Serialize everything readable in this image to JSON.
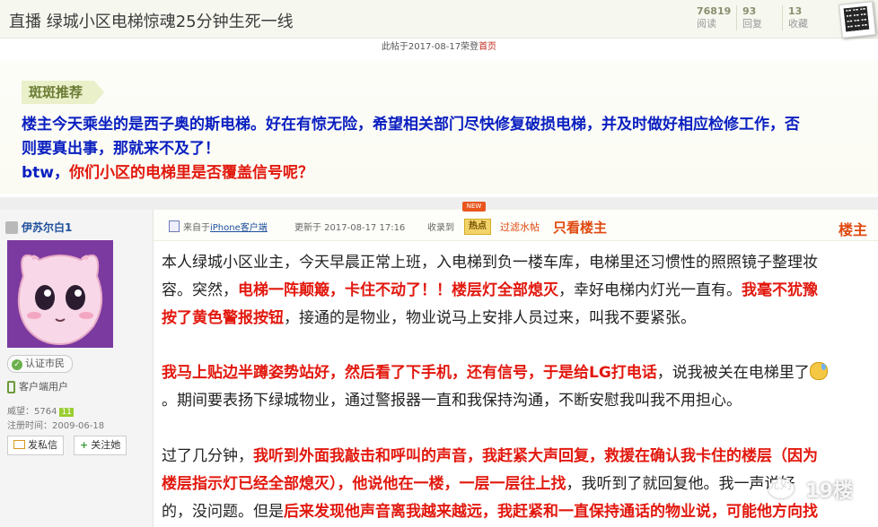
{
  "header": {
    "title": "直播 绿城小区电梯惊魂25分钟生死一线",
    "stats": [
      {
        "value": "76819",
        "label": "阅读"
      },
      {
        "value": "93",
        "label": "回复"
      },
      {
        "value": "13",
        "label": "收藏"
      }
    ],
    "pinned_text": "此帖于2017-08-17荣登",
    "pinned_link": "首页"
  },
  "recommendation": {
    "tag": "斑斑推荐",
    "line1": "楼主今天乘坐的是西子奥的斯电梯。好在有惊无险，希望相关部门尽快修复破损电梯，并及时做好相应检修工作，否",
    "line2": "则要真出事，那就来不及了！",
    "line3_blue": "btw，",
    "line3_red": "你们小区的电梯里是否覆盖信号呢？"
  },
  "user": {
    "name": "伊苏尔白1",
    "certified": "认证市民",
    "client_user": "客户端用户",
    "prestige": "威望：5764",
    "level": "11",
    "registered": "注册时间：2009-06-18",
    "message_button": "发私信",
    "follow_button": "关注她"
  },
  "post_header": {
    "source_prefix": "来自于",
    "source_link": "iPhone客户端",
    "updated": "更新于 2017-08-17 17:16",
    "collected": "收录到",
    "new_tag": "NEW",
    "hot_tag": "热点",
    "filter": "过滤水帖",
    "only_host": "只看楼主",
    "host_label": "楼主"
  },
  "post_body": {
    "p1_l1": "本人绿城小区业主，今天早晨正常上班，入电梯到负一楼车库，电梯里还习惯性的照照镜子整理妆",
    "p1_l2_a": "容。突然，",
    "p1_l2_b": "电梯一阵颠簸，卡住不动了！！楼层灯全部熄灭",
    "p1_l2_c": "，幸好电梯内灯光一直有。",
    "p1_l2_d": "我毫不犹豫",
    "p1_l3_a": "按了黄色警报按钮",
    "p1_l3_b": "，接通的是物业，物业说马上安排人员过来，叫我不要紧张。",
    "p2_l1_a": "我马上贴边半蹲姿势站好，然后看了下手机，还有信号，于是给LG打电话",
    "p2_l1_b": "，说我被关在电梯里了",
    "p2_l2": "。期间要表扬下绿城物业，通过警报器一直和我保持沟通，不断安慰我叫我不用担心。",
    "p3_l1_a": "过了几分钟，",
    "p3_l1_b": "我听到外面我敲击和呼叫的声音，我赶紧大声回复，救援在确认我卡住的楼层（因为",
    "p3_l2_a": "楼层指示灯已经全部熄灭），他说他在一楼，一层一层往上找",
    "p3_l2_b": "，我听到了就回复他。我一声说好",
    "p3_l3_a": "的，没问题。但是",
    "p3_l3_b": "后来发现他声音离我越来越远，我赶紧和一直保持通话的物业说，可能他方向找"
  },
  "watermark": "19楼"
}
